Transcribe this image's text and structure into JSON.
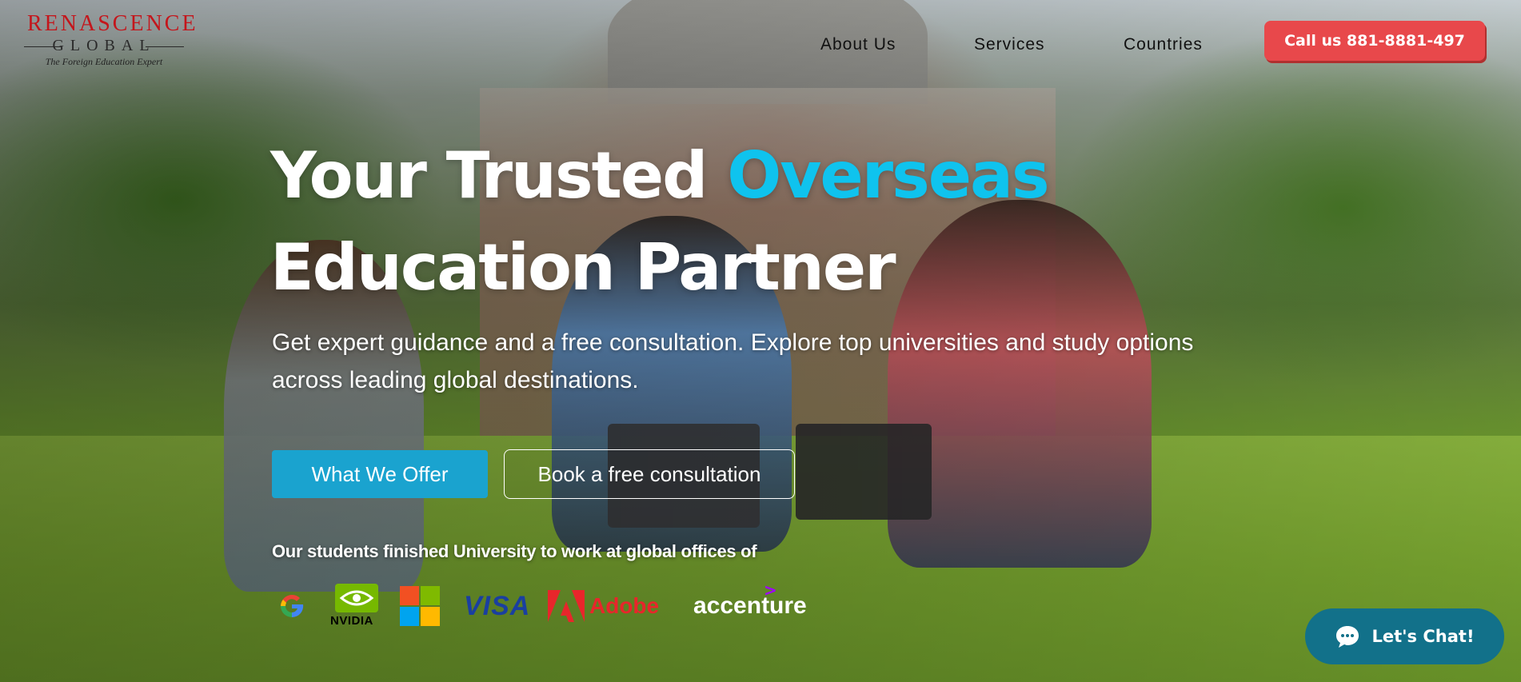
{
  "logo": {
    "brand_top": "RENASCENCE",
    "brand_bottom": "GLOBAL",
    "tagline": "The Foreign Education Expert"
  },
  "nav": {
    "items": [
      {
        "label": "About Us"
      },
      {
        "label": "Services"
      },
      {
        "label": "Countries"
      }
    ],
    "call_label": "Call us 881-8881-497"
  },
  "hero": {
    "headline_part1": "Your Trusted ",
    "headline_accent": "Overseas",
    "headline_part2": "Education Partner",
    "subtext": "Get expert guidance and a free consultation. Explore top universities and study options across leading global destinations.",
    "primary_button": "What We Offer",
    "secondary_button": "Book a free consultation",
    "students_line": "Our students finished University to work at global offices of"
  },
  "partner_logos": [
    {
      "name": "Google",
      "icon": "google-icon"
    },
    {
      "name": "NVIDIA",
      "icon": "nvidia-icon"
    },
    {
      "name": "Microsoft",
      "icon": "microsoft-icon"
    },
    {
      "name": "VISA",
      "icon": "visa-logo"
    },
    {
      "name": "Adobe",
      "icon": "adobe-icon"
    },
    {
      "name": "accenture",
      "icon": "accenture-logo"
    }
  ],
  "chat": {
    "label": "Let's Chat!",
    "icon": "chat-bubble-icon"
  },
  "colors": {
    "accent": "#0fc3ee",
    "call_button": "#e8484b",
    "primary_button": "#1aa3cf",
    "chat_button": "#12718a",
    "logo_red": "#c4161c"
  }
}
